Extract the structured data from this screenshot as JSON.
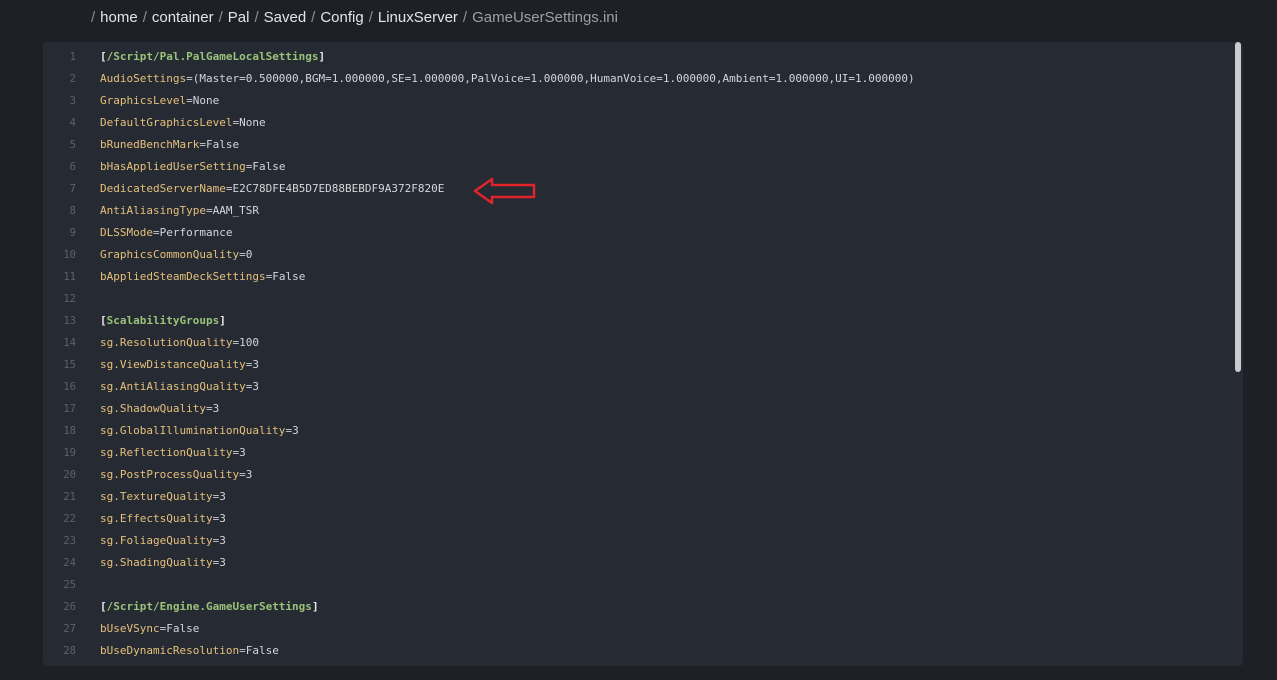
{
  "breadcrumb": {
    "items": [
      "home",
      "container",
      "Pal",
      "Saved",
      "Config",
      "LinuxServer"
    ],
    "current": "GameUserSettings.ini",
    "separator": "/"
  },
  "editor": {
    "lines": [
      {
        "num": "1",
        "type": "section",
        "text": "/Script/Pal.PalGameLocalSettings"
      },
      {
        "num": "2",
        "type": "kv",
        "key": "AudioSettings",
        "value": "(Master=0.500000,BGM=1.000000,SE=1.000000,PalVoice=1.000000,HumanVoice=1.000000,Ambient=1.000000,UI=1.000000)"
      },
      {
        "num": "3",
        "type": "kv",
        "key": "GraphicsLevel",
        "value": "None"
      },
      {
        "num": "4",
        "type": "kv",
        "key": "DefaultGraphicsLevel",
        "value": "None"
      },
      {
        "num": "5",
        "type": "kv",
        "key": "bRunedBenchMark",
        "value": "False"
      },
      {
        "num": "6",
        "type": "kv",
        "key": "bHasAppliedUserSetting",
        "value": "False"
      },
      {
        "num": "7",
        "type": "kv",
        "key": "DedicatedServerName",
        "value": "E2C78DFE4B5D7ED88BEBDF9A372F820E"
      },
      {
        "num": "8",
        "type": "kv",
        "key": "AntiAliasingType",
        "value": "AAM_TSR"
      },
      {
        "num": "9",
        "type": "kv",
        "key": "DLSSMode",
        "value": "Performance"
      },
      {
        "num": "10",
        "type": "kv",
        "key": "GraphicsCommonQuality",
        "value": "0"
      },
      {
        "num": "11",
        "type": "kv",
        "key": "bAppliedSteamDeckSettings",
        "value": "False"
      },
      {
        "num": "12",
        "type": "blank"
      },
      {
        "num": "13",
        "type": "section",
        "text": "ScalabilityGroups"
      },
      {
        "num": "14",
        "type": "kv",
        "key": "sg.ResolutionQuality",
        "value": "100"
      },
      {
        "num": "15",
        "type": "kv",
        "key": "sg.ViewDistanceQuality",
        "value": "3"
      },
      {
        "num": "16",
        "type": "kv",
        "key": "sg.AntiAliasingQuality",
        "value": "3"
      },
      {
        "num": "17",
        "type": "kv",
        "key": "sg.ShadowQuality",
        "value": "3"
      },
      {
        "num": "18",
        "type": "kv",
        "key": "sg.GlobalIlluminationQuality",
        "value": "3"
      },
      {
        "num": "19",
        "type": "kv",
        "key": "sg.ReflectionQuality",
        "value": "3"
      },
      {
        "num": "20",
        "type": "kv",
        "key": "sg.PostProcessQuality",
        "value": "3"
      },
      {
        "num": "21",
        "type": "kv",
        "key": "sg.TextureQuality",
        "value": "3"
      },
      {
        "num": "22",
        "type": "kv",
        "key": "sg.EffectsQuality",
        "value": "3"
      },
      {
        "num": "23",
        "type": "kv",
        "key": "sg.FoliageQuality",
        "value": "3"
      },
      {
        "num": "24",
        "type": "kv",
        "key": "sg.ShadingQuality",
        "value": "3"
      },
      {
        "num": "25",
        "type": "blank"
      },
      {
        "num": "26",
        "type": "section",
        "text": "/Script/Engine.GameUserSettings"
      },
      {
        "num": "27",
        "type": "kv",
        "key": "bUseVSync",
        "value": "False"
      },
      {
        "num": "28",
        "type": "kv",
        "key": "bUseDynamicResolution",
        "value": "False"
      }
    ]
  },
  "annotation": {
    "arrow_color": "#e0242b"
  },
  "colors": {
    "background": "#1e2025",
    "editor_bg": "#262a33",
    "key": "#e5c07b",
    "section": "#98c379",
    "line_number": "#5c626d"
  }
}
